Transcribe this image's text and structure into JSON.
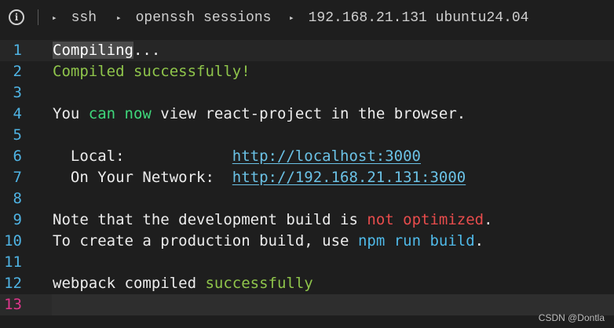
{
  "breadcrumb": {
    "info_icon_glyph": "i",
    "arrow_glyph": "▸",
    "items": [
      "ssh",
      "openssh sessions",
      "192.168.21.131 ubuntu24.04"
    ]
  },
  "editor": {
    "lines": [
      {
        "n": "1",
        "segments": [
          {
            "t": "Compiling",
            "c": "sel"
          },
          {
            "t": "...",
            "c": "default"
          }
        ]
      },
      {
        "n": "2",
        "segments": [
          {
            "t": "Compiled successfully!",
            "c": "green"
          }
        ]
      },
      {
        "n": "3",
        "segments": []
      },
      {
        "n": "4",
        "segments": [
          {
            "t": "You ",
            "c": "default"
          },
          {
            "t": "can now",
            "c": "bgreen"
          },
          {
            "t": " view react-project in the browser.",
            "c": "default"
          }
        ]
      },
      {
        "n": "5",
        "segments": []
      },
      {
        "n": "6",
        "segments": [
          {
            "t": "  Local:            ",
            "c": "default"
          },
          {
            "t": "http://localhost:3000",
            "c": "link"
          }
        ]
      },
      {
        "n": "7",
        "segments": [
          {
            "t": "  On Your Network:  ",
            "c": "default"
          },
          {
            "t": "http://192.168.21.131:3000",
            "c": "link"
          }
        ]
      },
      {
        "n": "8",
        "segments": []
      },
      {
        "n": "9",
        "segments": [
          {
            "t": "Note that the development build is ",
            "c": "default"
          },
          {
            "t": "not optimized",
            "c": "red"
          },
          {
            "t": ".",
            "c": "default"
          }
        ]
      },
      {
        "n": "10",
        "segments": [
          {
            "t": "To create a production build, use ",
            "c": "default"
          },
          {
            "t": "npm run build",
            "c": "cyan"
          },
          {
            "t": ".",
            "c": "default"
          }
        ]
      },
      {
        "n": "11",
        "segments": []
      },
      {
        "n": "12",
        "segments": [
          {
            "t": "webpack compiled ",
            "c": "default"
          },
          {
            "t": "successfully",
            "c": "green"
          }
        ]
      },
      {
        "n": "13",
        "segments": [],
        "current": true
      }
    ]
  },
  "watermark": "CSDN @Dontla",
  "colors": {
    "background": "#1e1e1e",
    "line_number": "#4fb3e3",
    "current_line_number": "#e0368c",
    "green": "#8fc54b",
    "bright_green": "#3fd77b",
    "red": "#e84c4c",
    "cyan": "#4fb9e8",
    "link": "#6bc2e6"
  }
}
